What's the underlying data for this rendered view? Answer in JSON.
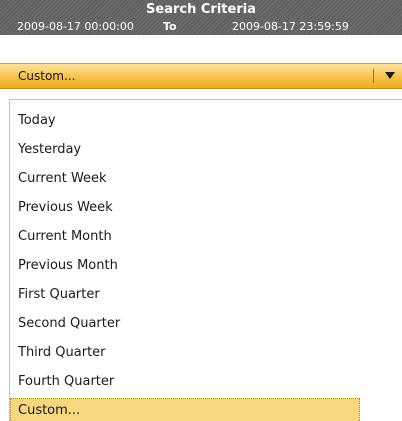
{
  "header": {
    "title": "Search Criteria",
    "date_from": "2009-08-17 00:00:00",
    "to_label": "To",
    "date_to": "2009-08-17 23:59:59"
  },
  "select": {
    "value": "Custom...",
    "icon": "chevron-down-icon"
  },
  "dropdown": {
    "items": [
      {
        "label": "Today",
        "selected": false
      },
      {
        "label": "Yesterday",
        "selected": false
      },
      {
        "label": "Current Week",
        "selected": false
      },
      {
        "label": "Previous Week",
        "selected": false
      },
      {
        "label": "Current Month",
        "selected": false
      },
      {
        "label": "Previous Month",
        "selected": false
      },
      {
        "label": "First Quarter",
        "selected": false
      },
      {
        "label": "Second Quarter",
        "selected": false
      },
      {
        "label": "Third Quarter",
        "selected": false
      },
      {
        "label": "Fourth Quarter",
        "selected": false
      },
      {
        "label": "Custom...",
        "selected": true
      }
    ]
  },
  "colors": {
    "header_bg": "#666666",
    "accent": "#f7c14b",
    "selected_item_bg": "#f9d77f"
  }
}
